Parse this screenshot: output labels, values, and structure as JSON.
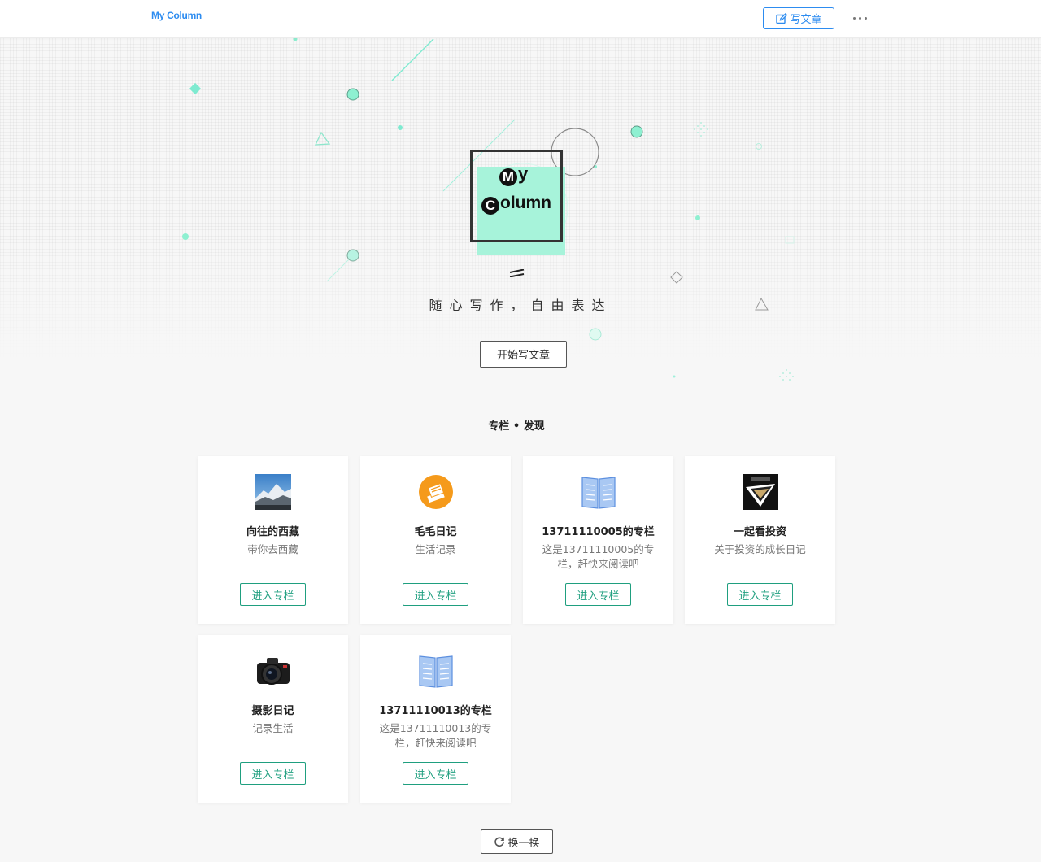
{
  "header": {
    "brand": "My Column",
    "write_label": "写文章",
    "write_icon": "edit-icon",
    "more_icon": "ellipsis-icon",
    "accent_color": "#2d8cf0"
  },
  "hero": {
    "logo_line1": "My",
    "logo_line1_cap": "M",
    "logo_line1_rest": "y",
    "logo_line2_cap": "C",
    "logo_line2_rest": "olumn",
    "slogan": "随心写作，自由表达",
    "start_label": "开始写文章",
    "logo_color": "#a7f3da"
  },
  "discover": {
    "title": "专栏 • 发现",
    "enter_label": "进入专栏",
    "refresh_label": "换一换",
    "refresh_icon": "refresh-icon",
    "button_color": "#1f9f7f",
    "cards": [
      {
        "title": "向往的西藏",
        "desc": "带你去西藏",
        "icon": "mountain-photo"
      },
      {
        "title": "毛毛日记",
        "desc": "生活记录",
        "icon": "orange-notebook-icon"
      },
      {
        "title": "13711110005的专栏",
        "desc": "这是13711110005的专栏，赶快来阅读吧",
        "icon": "open-book-icon"
      },
      {
        "title": "一起看投资",
        "desc": "关于投资的成长日记",
        "icon": "investor-logo-icon"
      },
      {
        "title": "摄影日记",
        "desc": "记录生活",
        "icon": "camera-icon"
      },
      {
        "title": "13711110013的专栏",
        "desc": "这是13711110013的专栏，赶快来阅读吧",
        "icon": "open-book-icon"
      }
    ]
  }
}
